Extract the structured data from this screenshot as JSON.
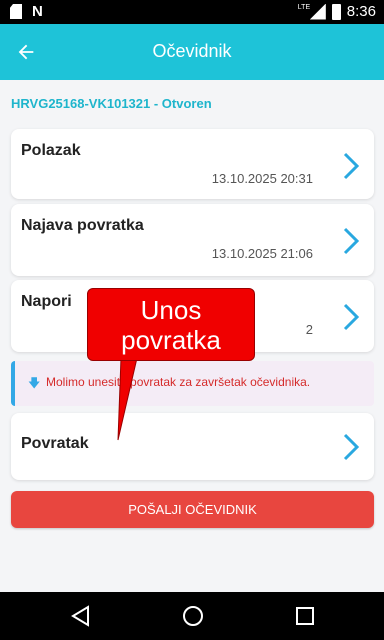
{
  "status_bar": {
    "network": "LTE",
    "time": "8:36",
    "icons": [
      "sd-card-icon",
      "n-icon",
      "signal-icon",
      "battery-icon"
    ]
  },
  "app_bar": {
    "title": "Očevidnik",
    "back_icon": "arrow-left-icon"
  },
  "record": {
    "id_status": "HRVG25168-VK101321 - Otvoren"
  },
  "cards": [
    {
      "title": "Polazak",
      "value": "13.10.2025 20:31"
    },
    {
      "title": "Najava povratka",
      "value": "13.10.2025 21:06"
    },
    {
      "title": "Napori",
      "value": "2"
    },
    {
      "title": "Povratak",
      "value": ""
    }
  ],
  "alert": {
    "icon": "arrow-down-icon",
    "text": "Molimo unesite povratak za završetak očevidnika."
  },
  "submit": {
    "label": "POŠALJI OČEVIDNIK"
  },
  "callout": {
    "line1": "Unos",
    "line2": "povratka"
  },
  "colors": {
    "app_bar": "#1ec3d8",
    "accent": "#1eb5cc",
    "chevron": "#29a8e0",
    "submit": "#e8463f",
    "alert_text": "#d52b2b",
    "callout": "#f00000"
  }
}
